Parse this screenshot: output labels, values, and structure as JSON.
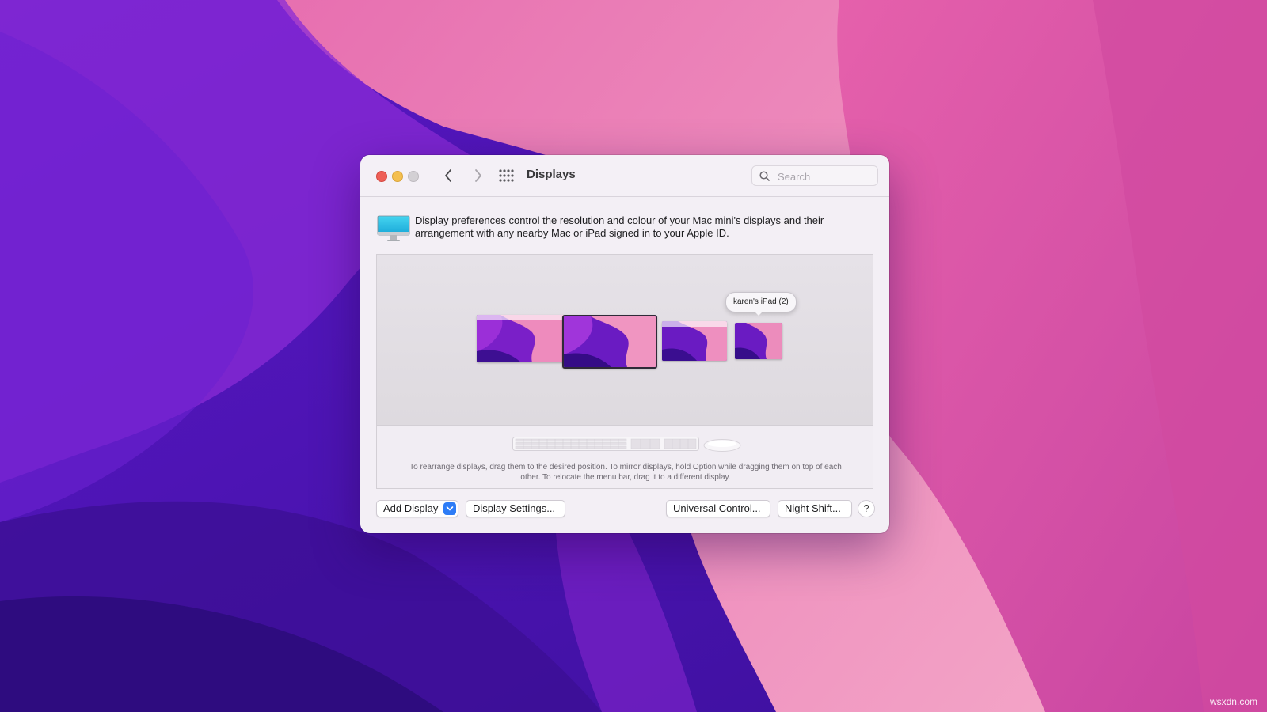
{
  "window": {
    "title": "Displays",
    "search_placeholder": "Search"
  },
  "intro": {
    "text": "Display preferences control the resolution and colour of your Mac mini's displays and their arrangement with any nearby Mac or iPad signed in to your Apple ID."
  },
  "arrangement": {
    "tooltip": "karen's iPad (2)",
    "hint": "To rearrange displays, drag them to the desired position. To mirror displays, hold Option while dragging them on top of each other. To relocate the menu bar, drag it to a different display."
  },
  "buttons": {
    "add_display": "Add Display",
    "display_settings": "Display Settings...",
    "universal_control": "Universal Control...",
    "night_shift": "Night Shift...",
    "help": "?"
  },
  "watermark": "wsxdn.com",
  "colors": {
    "accent": "#2d7cf6",
    "close": "#ee5f57",
    "minimize": "#f4bf4f"
  }
}
